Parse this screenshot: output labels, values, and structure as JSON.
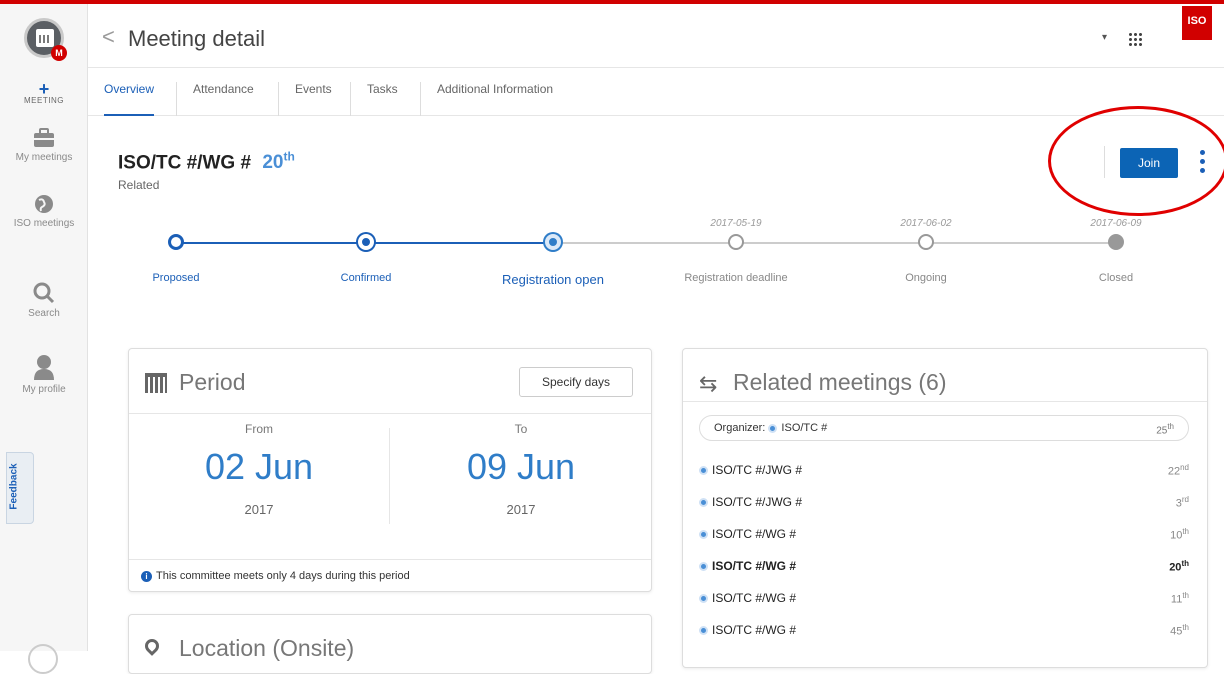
{
  "header": {
    "back_glyph": "<",
    "title": "Meeting detail",
    "dropdown_glyph": "▾",
    "iso_logo": "ISO"
  },
  "sidebar": {
    "new_meeting": {
      "plus": "+",
      "label": "MEETING"
    },
    "items": [
      {
        "label": "My meetings",
        "icon": "briefcase-icon"
      },
      {
        "label": "ISO meetings",
        "icon": "globe-icon"
      },
      {
        "label": "Search",
        "icon": "search-icon"
      },
      {
        "label": "My profile",
        "icon": "person-icon"
      }
    ],
    "feedback": "Feedback",
    "app_badge": "M"
  },
  "tabs": [
    "Overview",
    "Attendance",
    "Events",
    "Tasks",
    "Additional Information"
  ],
  "meeting": {
    "title": "ISO/TC #/WG #",
    "ordinal_num": "20",
    "ordinal_suffix": "th",
    "related": "Related"
  },
  "actions": {
    "join": "Join"
  },
  "timeline": [
    {
      "label": "Proposed",
      "date": ""
    },
    {
      "label": "Confirmed",
      "date": ""
    },
    {
      "label": "Registration open",
      "date": ""
    },
    {
      "label": "Registration deadline",
      "date": "2017-05-19"
    },
    {
      "label": "Ongoing",
      "date": "2017-06-02"
    },
    {
      "label": "Closed",
      "date": "2017-06-09"
    }
  ],
  "period": {
    "title": "Period",
    "specify_button": "Specify days",
    "from_label": "From",
    "from_date": "02 Jun",
    "from_year": "2017",
    "to_label": "To",
    "to_date": "09 Jun",
    "to_year": "2017",
    "info_glyph": "i",
    "note": "This committee meets only 4 days during this period"
  },
  "location": {
    "title": "Location (Onsite)"
  },
  "related_meetings": {
    "title": "Related meetings (6)",
    "organizer": {
      "label": "Organizer:",
      "name": "ISO/TC #",
      "num": "25",
      "suffix": "th"
    },
    "rows": [
      {
        "name": "ISO/TC #/JWG #",
        "num": "22",
        "suffix": "nd"
      },
      {
        "name": "ISO/TC #/JWG #",
        "num": "3",
        "suffix": "rd"
      },
      {
        "name": "ISO/TC #/WG #",
        "num": "10",
        "suffix": "th"
      },
      {
        "name": "ISO/TC #/WG #",
        "num": "20",
        "suffix": "th"
      },
      {
        "name": "ISO/TC #/WG #",
        "num": "11",
        "suffix": "th"
      },
      {
        "name": "ISO/TC #/WG #",
        "num": "45",
        "suffix": "th"
      }
    ]
  },
  "colors": {
    "accent": "#1b5fb7",
    "brand_red": "#d10000",
    "active_step": "#2f7dc8",
    "annotation": "#e00000"
  }
}
